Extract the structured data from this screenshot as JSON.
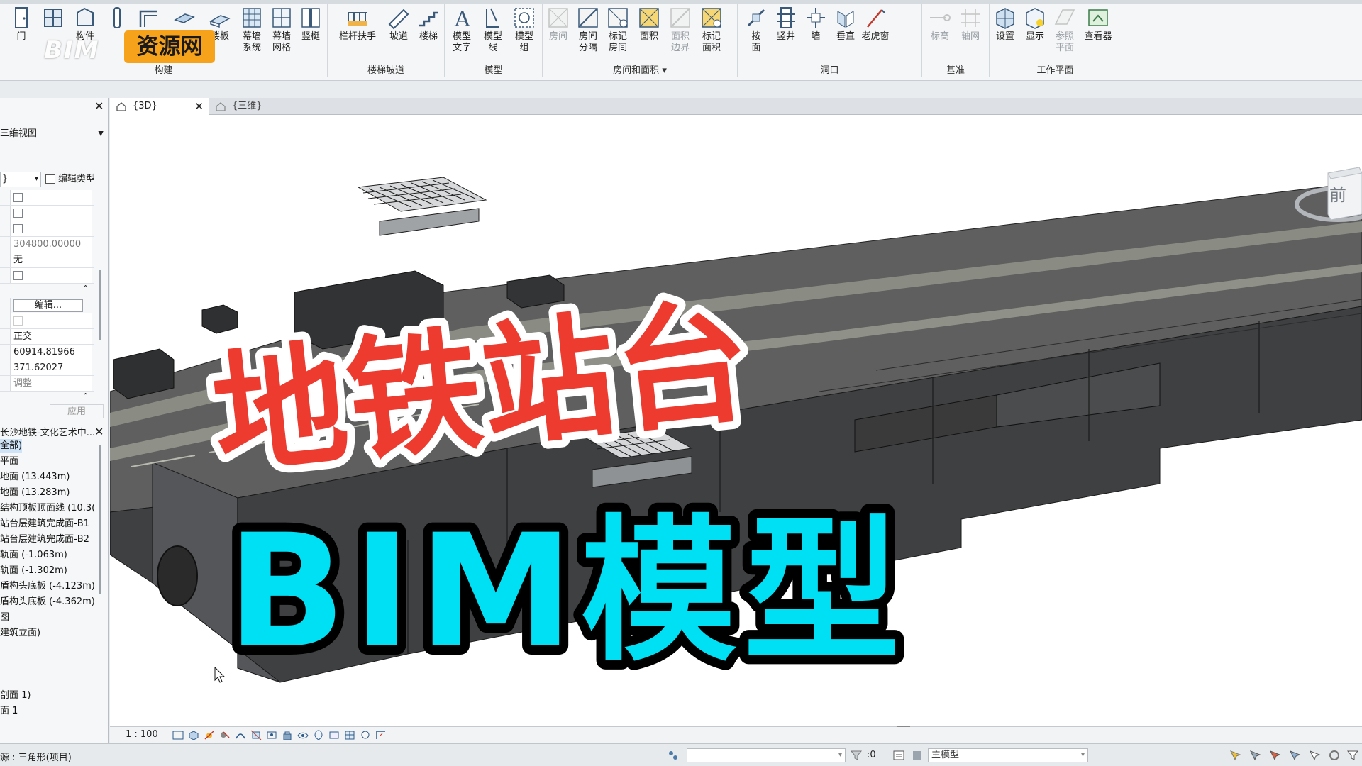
{
  "ribbon": {
    "tools": [
      {
        "label": "门"
      },
      {
        "label": "构件"
      },
      {
        "label": "楼板"
      },
      {
        "label": "幕墙\n系统"
      },
      {
        "label": "幕墙\n网格"
      },
      {
        "label": "竖梃"
      },
      {
        "label": "栏杆扶手"
      },
      {
        "label": "坡道"
      },
      {
        "label": "楼梯"
      },
      {
        "label": "模型\n文字"
      },
      {
        "label": "模型\n线"
      },
      {
        "label": "模型\n组"
      },
      {
        "label": "房间"
      },
      {
        "label": "房间\n分隔"
      },
      {
        "label": "标记\n房间"
      },
      {
        "label": "面积"
      },
      {
        "label": "面积\n边界"
      },
      {
        "label": "标记\n面积"
      },
      {
        "label": "按\n面"
      },
      {
        "label": "竖井"
      },
      {
        "label": "墙"
      },
      {
        "label": "垂直"
      },
      {
        "label": "老虎窗"
      },
      {
        "label": "标高"
      },
      {
        "label": "轴网"
      },
      {
        "label": "设置"
      },
      {
        "label": "显示"
      },
      {
        "label": "参照\n平面"
      },
      {
        "label": "查看器"
      }
    ],
    "panels": [
      "构建",
      "楼梯坡道",
      "模型",
      "房间和面积",
      "洞口",
      "基准",
      "工作平面"
    ],
    "watermark": {
      "bim": "BIM",
      "box": "资源网"
    }
  },
  "properties": {
    "type": "三维视图",
    "instance": "}",
    "edit_type": "编辑类型",
    "value_distance": "304800.00000",
    "value_none": "无",
    "edit_button": "编辑...",
    "value_projection": "正交",
    "value_a": "60914.81966",
    "value_b": "371.62027",
    "value_adjust": "调整",
    "apply": "应用"
  },
  "browser": {
    "title": "长沙地铁-文化艺术中...",
    "items": [
      "全部)",
      "平面",
      "地面 (13.443m)",
      "地面 (13.283m)",
      "结构顶板顶面线 (10.3(",
      "站台层建筑完成面-B1",
      "站台层建筑完成面-B2",
      "轨面 (-1.063m)",
      "轨面 (-1.302m)",
      "盾构头底板 (-4.123m)",
      "盾构头底板 (-4.362m)",
      "图",
      "建筑立面)",
      "剖面 1)",
      "面 1"
    ]
  },
  "tabs": [
    {
      "label": "{3D}"
    },
    {
      "label": "{三维}"
    }
  ],
  "viewcube": {
    "face": "前"
  },
  "overlay": {
    "line1": "地铁站台",
    "line2": "BIM模型"
  },
  "view_control": {
    "scale": "1 : 100"
  },
  "status": {
    "left_text": "源 : 三角形(项目)",
    "count": ":0",
    "model": "主模型"
  },
  "colors": {
    "title_red": "#ee3b30",
    "title_cyan": "#00e0f5",
    "watermark_orange": "#f6a21a",
    "model_dark": "#4a4b4d",
    "model_light": "#8b8d86"
  }
}
